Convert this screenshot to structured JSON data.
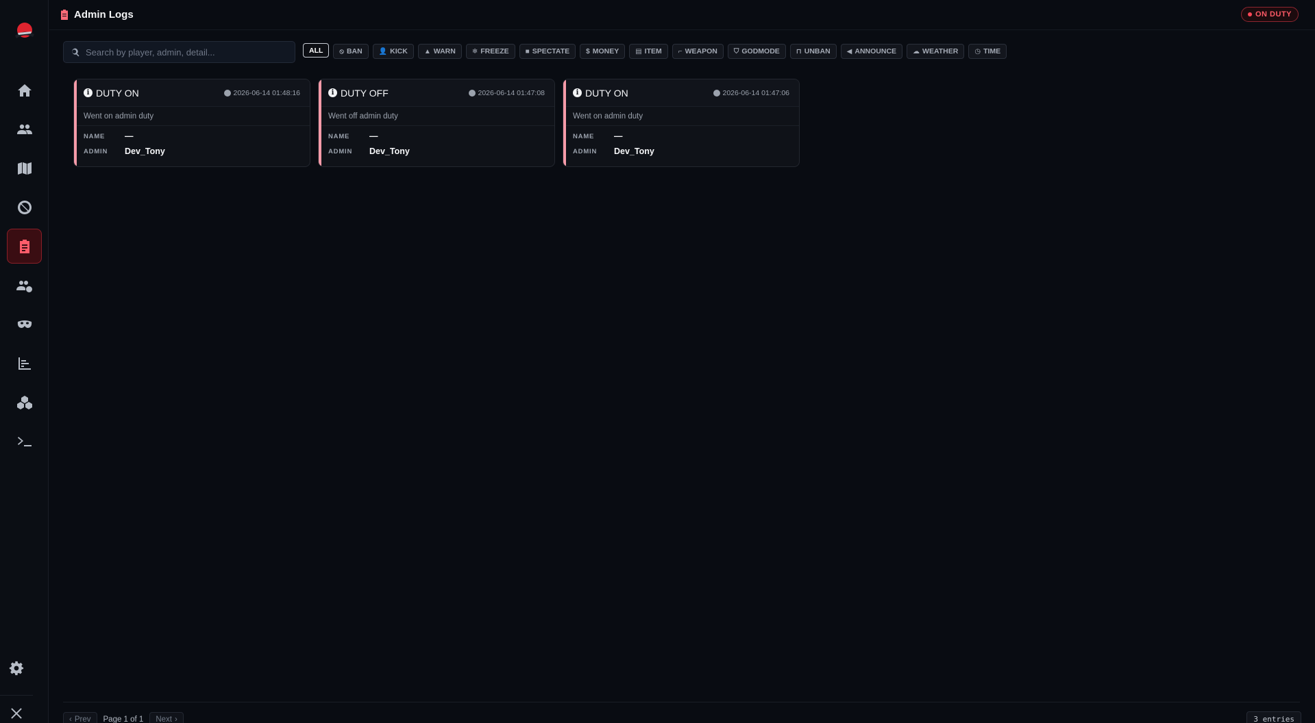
{
  "header": {
    "title": "Admin Logs",
    "duty_badge": "ON DUTY"
  },
  "colors": {
    "accent": "#ff4757",
    "card_stripe": "#f59aa8",
    "background": "#090c12"
  },
  "sidebar": {
    "items": [
      {
        "icon": "home-icon"
      },
      {
        "icon": "users-icon"
      },
      {
        "icon": "map-icon"
      },
      {
        "icon": "ban-icon"
      },
      {
        "icon": "clipboard-icon",
        "active": true
      },
      {
        "icon": "users-gear-icon"
      },
      {
        "icon": "mask-icon"
      },
      {
        "icon": "chart-icon"
      },
      {
        "icon": "boxes-icon"
      },
      {
        "icon": "terminal-icon"
      }
    ],
    "bottom": [
      {
        "icon": "gear-icon"
      },
      {
        "icon": "close-icon"
      }
    ]
  },
  "search": {
    "placeholder": "Search by player, admin, detail...",
    "value": ""
  },
  "filters": [
    {
      "label": "ALL",
      "icon": "",
      "active": true
    },
    {
      "label": "BAN",
      "icon": "ban-icon"
    },
    {
      "label": "KICK",
      "icon": "user-minus-icon"
    },
    {
      "label": "WARN",
      "icon": "warning-icon"
    },
    {
      "label": "FREEZE",
      "icon": "snowflake-icon"
    },
    {
      "label": "SPECTATE",
      "icon": "video-icon"
    },
    {
      "label": "MONEY",
      "icon": "dollar-icon"
    },
    {
      "label": "ITEM",
      "icon": "box-icon"
    },
    {
      "label": "WEAPON",
      "icon": "gun-icon"
    },
    {
      "label": "GODMODE",
      "icon": "shield-icon"
    },
    {
      "label": "UNBAN",
      "icon": "unlock-icon"
    },
    {
      "label": "ANNOUNCE",
      "icon": "megaphone-icon"
    },
    {
      "label": "WEATHER",
      "icon": "cloud-icon"
    },
    {
      "label": "TIME",
      "icon": "clock-icon"
    }
  ],
  "logs": [
    {
      "type": "DUTY ON",
      "timestamp": "2026-06-14 01:48:16",
      "detail": "Went on admin duty",
      "name_label": "NAME",
      "name": "—",
      "admin_label": "ADMIN",
      "admin": "Dev_Tony"
    },
    {
      "type": "DUTY OFF",
      "timestamp": "2026-06-14 01:47:08",
      "detail": "Went off admin duty",
      "name_label": "NAME",
      "name": "—",
      "admin_label": "ADMIN",
      "admin": "Dev_Tony"
    },
    {
      "type": "DUTY ON",
      "timestamp": "2026-06-14 01:47:06",
      "detail": "Went on admin duty",
      "name_label": "NAME",
      "name": "—",
      "admin_label": "ADMIN",
      "admin": "Dev_Tony"
    }
  ],
  "pagination": {
    "prev": "Prev",
    "page_label": "Page 1 of 1",
    "next": "Next",
    "entries": "3 entries"
  }
}
